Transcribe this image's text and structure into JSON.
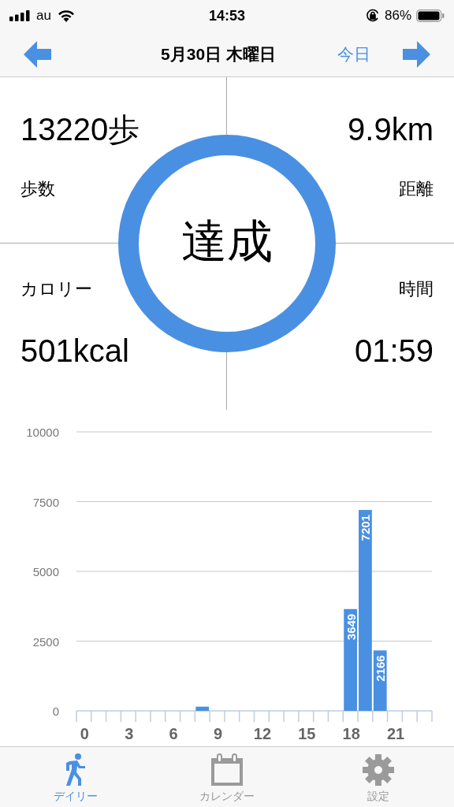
{
  "status_bar": {
    "carrier": "au",
    "time": "14:53",
    "battery": "86%"
  },
  "nav": {
    "title": "5月30日 木曜日",
    "today": "今日"
  },
  "stats": [
    {
      "value": "13220歩",
      "label": "歩数"
    },
    {
      "value": "9.9km",
      "label": "距離"
    },
    {
      "value": "501kcal",
      "label": "カロリー"
    },
    {
      "value": "01:59",
      "label": "時間"
    }
  ],
  "goal": {
    "label": "達成",
    "level": 1
  },
  "chart": {
    "chart_data": {
      "type": "bar",
      "x": [
        0,
        1,
        2,
        3,
        4,
        5,
        6,
        7,
        8,
        9,
        10,
        11,
        12,
        13,
        14,
        15,
        16,
        17,
        18,
        19,
        20,
        21,
        22,
        23
      ],
      "grid": true,
      "xlim": [
        -0.5,
        23.5
      ],
      "values": [
        0,
        0,
        0,
        0,
        0,
        0,
        0,
        0,
        150,
        0,
        0,
        0,
        0,
        0,
        0,
        0,
        0,
        0,
        3649,
        7201,
        2166,
        0,
        0,
        0
      ],
      "ylim": [
        0,
        10000
      ],
      "yticks": [
        0,
        2500,
        5000,
        7500,
        10000
      ],
      "xticks": [
        {
          "value": 0,
          "label": "0"
        },
        {
          "value": 3,
          "label": "3"
        },
        {
          "value": 6,
          "label": "6"
        },
        {
          "value": 9,
          "label": "9"
        },
        {
          "value": 12,
          "label": "12"
        },
        {
          "value": 15,
          "label": "15"
        },
        {
          "value": 18,
          "label": "18"
        },
        {
          "value": 21,
          "label": "21"
        }
      ],
      "value_labels": [
        null,
        null,
        null,
        null,
        null,
        null,
        null,
        null,
        null,
        null,
        null,
        null,
        null,
        null,
        null,
        null,
        null,
        null,
        "3649",
        "7201",
        "2166",
        null,
        null,
        null
      ]
    }
  },
  "tabs": [
    {
      "label": "デイリー",
      "selected": true,
      "kind": "walk"
    },
    {
      "label": "カレンダー",
      "selected": false,
      "kind": "calendar"
    },
    {
      "label": "設定",
      "selected": false,
      "kind": "gear"
    }
  ]
}
